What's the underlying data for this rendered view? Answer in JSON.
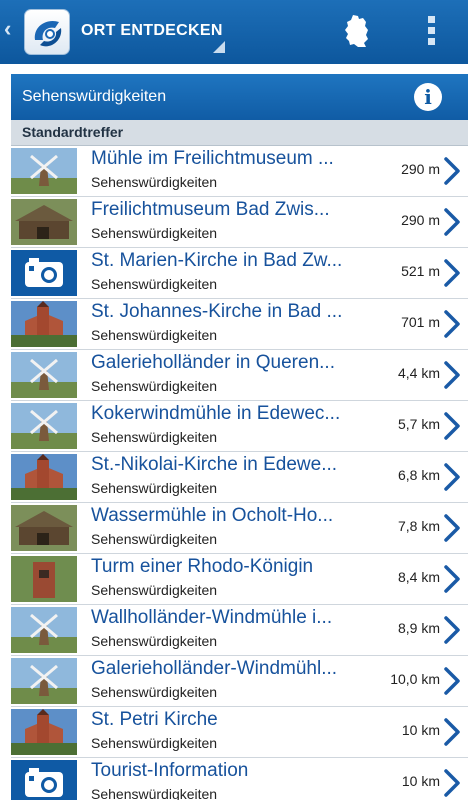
{
  "topbar": {
    "title": "ORT ENTDECKEN",
    "icons": [
      "back-chevron-icon",
      "app-logo",
      "germany-map-icon",
      "overflow-menu-icon"
    ]
  },
  "panel": {
    "title": "Sehenswürdigkeiten",
    "info_label": "i"
  },
  "section": {
    "label": "Standardtreffer"
  },
  "items": [
    {
      "title": "Mühle im Freilichtmuseum ...",
      "category": "Sehenswürdigkeiten",
      "distance": "290 m",
      "thumb": "windmill"
    },
    {
      "title": "Freilichtmuseum Bad Zwis...",
      "category": "Sehenswürdigkeiten",
      "distance": "290 m",
      "thumb": "barn"
    },
    {
      "title": "St. Marien-Kirche in Bad Zw...",
      "category": "Sehenswürdigkeiten",
      "distance": "521 m",
      "thumb": "camera"
    },
    {
      "title": "St. Johannes-Kirche in Bad ...",
      "category": "Sehenswürdigkeiten",
      "distance": "701 m",
      "thumb": "church"
    },
    {
      "title": "Galerieholländer in Queren...",
      "category": "Sehenswürdigkeiten",
      "distance": "4,4 km",
      "thumb": "windmill"
    },
    {
      "title": "Kokerwindmühle in Edewec...",
      "category": "Sehenswürdigkeiten",
      "distance": "5,7 km",
      "thumb": "windmill"
    },
    {
      "title": "St.-Nikolai-Kirche in Edewe...",
      "category": "Sehenswürdigkeiten",
      "distance": "6,8 km",
      "thumb": "church"
    },
    {
      "title": "Wassermühle in Ocholt-Ho...",
      "category": "Sehenswürdigkeiten",
      "distance": "7,8 km",
      "thumb": "barn"
    },
    {
      "title": "Turm einer Rhodo-Königin",
      "category": "Sehenswürdigkeiten",
      "distance": "8,4 km",
      "thumb": "tower"
    },
    {
      "title": "Wallholländer-Windmühle i...",
      "category": "Sehenswürdigkeiten",
      "distance": "8,9 km",
      "thumb": "windmill"
    },
    {
      "title": "Galerieholländer-Windmühl...",
      "category": "Sehenswürdigkeiten",
      "distance": "10,0 km",
      "thumb": "windmill"
    },
    {
      "title": "St. Petri Kirche",
      "category": "Sehenswürdigkeiten",
      "distance": "10 km",
      "thumb": "church"
    },
    {
      "title": "Tourist-Information",
      "category": "Sehenswürdigkeiten",
      "distance": "10 km",
      "thumb": "camera"
    }
  ],
  "colors": {
    "topbar": "#0d579d",
    "panel_header": "#105ca5",
    "link_text": "#17529c",
    "section_bg": "#d6dde4",
    "chevron": "#1a5aa6"
  }
}
